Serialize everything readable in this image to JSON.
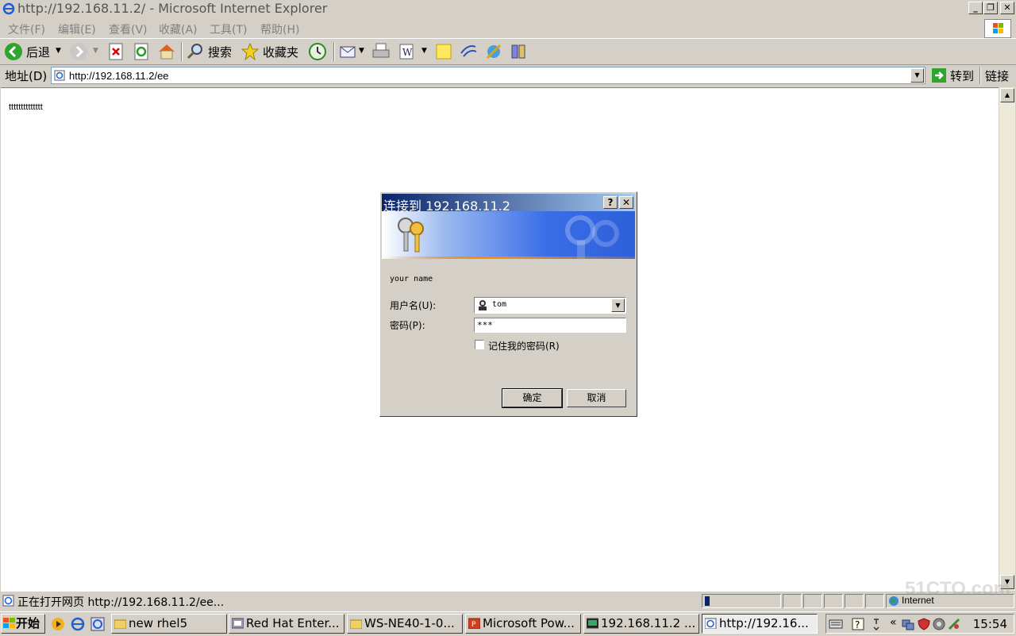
{
  "window": {
    "title": "http://192.168.11.2/ - Microsoft Internet Explorer",
    "min": "_",
    "max": "❐",
    "close": "✕"
  },
  "menu": [
    "文件(F)",
    "编辑(E)",
    "查看(V)",
    "收藏(A)",
    "工具(T)",
    "帮助(H)"
  ],
  "toolbar": {
    "back": "后退",
    "search": "搜索",
    "favorites": "收藏夹"
  },
  "address": {
    "label": "地址(D)",
    "url": "http://192.168.11.2/ee",
    "go": "转到",
    "links": "链接"
  },
  "page": {
    "text": "tttttttttttttt"
  },
  "dialog": {
    "title": "连接到 192.168.11.2",
    "help": "?",
    "close": "✕",
    "realm": "your name",
    "username_label": "用户名(U):",
    "username_value": "tom",
    "password_label": "密码(P):",
    "password_value": "***",
    "remember_label": "记住我的密码(R)",
    "ok": "确定",
    "cancel": "取消"
  },
  "status": {
    "text": "正在打开网页 http://192.168.11.2/ee...",
    "zone": "Internet"
  },
  "taskbar": {
    "start": "开始",
    "tasks": [
      "new rhel5",
      "Red Hat Enter...",
      "WS-NE40-1-0...",
      "Microsoft Pow...",
      "192.168.11.2 ...",
      "http://192.16..."
    ],
    "clock": "15:54"
  },
  "watermark": "51CTO.com",
  "colors": {
    "dialog_title": "#0a246a",
    "chrome": "#d4d0c8",
    "banner": "#2d5fd8"
  }
}
